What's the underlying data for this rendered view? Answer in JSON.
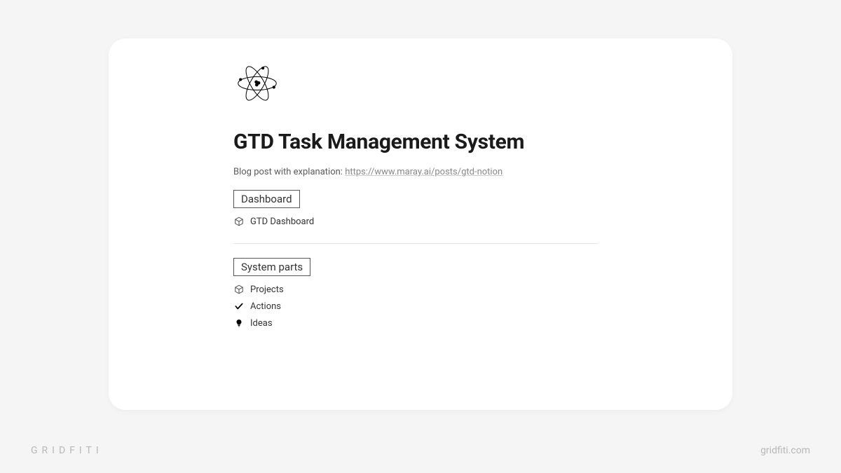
{
  "page": {
    "title": "GTD Task Management System",
    "blog_label": "Blog post with explanation: ",
    "blog_url": "https://www.maray.ai/posts/gtd-notion"
  },
  "sections": {
    "dashboard": {
      "header": "Dashboard",
      "items": [
        {
          "label": "GTD Dashboard",
          "icon": "cube-icon"
        }
      ]
    },
    "system_parts": {
      "header": "System parts",
      "items": [
        {
          "label": "Projects",
          "icon": "cube-icon"
        },
        {
          "label": "Actions",
          "icon": "check-icon"
        },
        {
          "label": "Ideas",
          "icon": "bulb-icon"
        }
      ]
    }
  },
  "watermark": {
    "left": "GRIDFITI",
    "right": "gridfiti.com"
  }
}
